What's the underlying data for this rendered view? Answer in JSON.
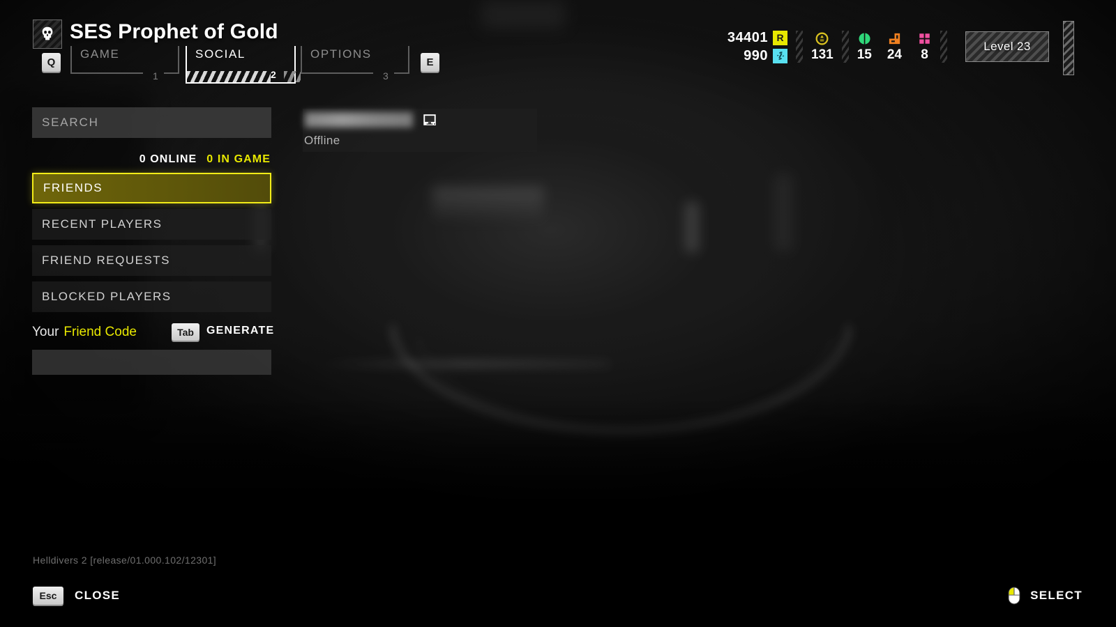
{
  "header": {
    "ship_name": "SES Prophet of Gold",
    "emblem_icon": "skull-icon",
    "prev_key": "Q",
    "next_key": "E",
    "tabs": [
      {
        "label": "GAME",
        "number": "1",
        "active": false
      },
      {
        "label": "SOCIAL",
        "number": "2",
        "active": true
      },
      {
        "label": "OPTIONS",
        "number": "3",
        "active": false
      }
    ]
  },
  "resources": {
    "requisition": {
      "value": "34401",
      "badge": "R",
      "icon": "requisition-icon",
      "badge_color": "#e8e800"
    },
    "supercredits": {
      "value": "990",
      "badge": "S",
      "icon": "supercredit-icon",
      "badge_color": "#58e0f0"
    },
    "medals": {
      "value": "131",
      "icon": "medal-icon",
      "color": "#d8c020"
    },
    "common_samples": {
      "value": "15",
      "icon": "common-sample-icon",
      "color": "#2fd87a"
    },
    "rare_samples": {
      "value": "24",
      "icon": "rare-sample-icon",
      "color": "#f08020"
    },
    "super_samples": {
      "value": "8",
      "icon": "super-sample-icon",
      "color": "#f050a0"
    },
    "level": "Level 23"
  },
  "sidebar": {
    "search": {
      "placeholder": "SEARCH",
      "value": ""
    },
    "counts": {
      "online": "0 ONLINE",
      "in_game": "0 IN GAME"
    },
    "items": [
      {
        "label": "FRIENDS",
        "selected": true
      },
      {
        "label": "RECENT PLAYERS",
        "selected": false
      },
      {
        "label": "FRIEND REQUESTS",
        "selected": false
      },
      {
        "label": "BLOCKED PLAYERS",
        "selected": false
      }
    ],
    "friend_code": {
      "prefix": "Your",
      "label": "Friend Code",
      "key": "Tab",
      "action": "GENERATE",
      "value": ""
    }
  },
  "detail": {
    "player_name": "",
    "platform_icon": "pc-monitor-icon",
    "status": "Offline"
  },
  "footer": {
    "build": "Helldivers 2 [release/01.000.102/12301]",
    "close_key": "Esc",
    "close_label": "CLOSE",
    "select_icon": "mouse-left-click-icon",
    "select_label": "SELECT"
  },
  "colors": {
    "accent_yellow": "#e8e800",
    "select_border": "#f2ec18",
    "text_primary": "#ffffff",
    "text_muted": "#a6a6a6"
  }
}
